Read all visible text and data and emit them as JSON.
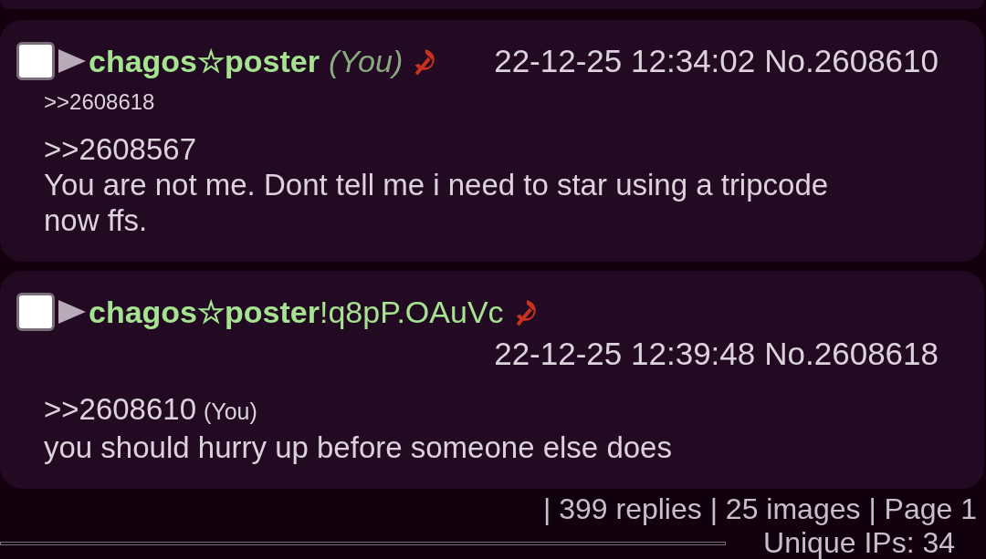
{
  "posts": [
    {
      "checked": false,
      "name": "chagos☆poster",
      "you_label": "(You)",
      "date": "22-12-25 12:34:02",
      "number": "No.2608610",
      "backlinks": [
        ">>2608618"
      ],
      "quotes": [
        {
          "text": ">>2608567"
        }
      ],
      "body": "You are not me. Dont tell me i need to star using a tripcode now ffs."
    },
    {
      "checked": false,
      "name": "chagos☆poster",
      "tripcode": "!q8pP.OAuVc",
      "date": "22-12-25 12:39:48",
      "number": "No.2608618",
      "quotes": [
        {
          "text": ">>2608610",
          "you_label": "(You)"
        }
      ],
      "body": "you should hurry up before someone else does"
    }
  ],
  "stats": "| 399 replies | 25 images | Page 1",
  "unique_ips": "Unique IPs: 34"
}
